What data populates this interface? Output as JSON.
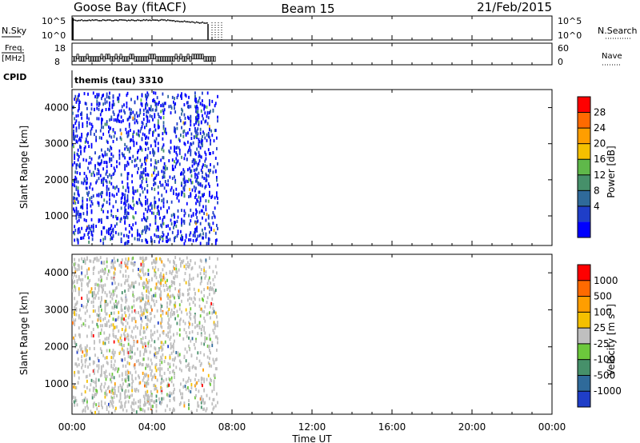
{
  "header": {
    "title": "Goose Bay (fitACF)",
    "beam": "Beam 15",
    "date": "21/Feb/2015"
  },
  "meta_panels": {
    "nsky_label": "N.Sky",
    "nsky_ticks": [
      "10^5",
      "10^0"
    ],
    "nsearch_label": "N.Search",
    "nsearch_ticks": [
      "10^5",
      "10^0"
    ],
    "freq_label_line1": "Freq.",
    "freq_label_line2": "[MHz]",
    "freq_ticks": [
      "18",
      "8"
    ],
    "nave_label": "Nave",
    "nave_ticks": [
      "60",
      "0"
    ],
    "cpid_label": "CPID",
    "cpid_value": "themis (tau) 3310",
    "data_end_hour": 7.3,
    "nsky_level_start": 0.85,
    "nsky_level_drop": 0.7
  },
  "chart_data": [
    {
      "type": "heatmap",
      "name": "power",
      "xlabel": "",
      "ylabel": "Slant Range [km]",
      "x_range_hours": [
        0,
        24
      ],
      "y_range_km": [
        180,
        4500
      ],
      "yticks": [
        1000,
        2000,
        3000,
        4000
      ],
      "data_end_hour": 7.3,
      "colorbar": {
        "label": "Power [dB]",
        "ticks": [
          "28",
          "24",
          "20",
          "16",
          "12",
          "8",
          "4"
        ],
        "colors": [
          "#0000ff",
          "#1f3ec8",
          "#2f6a9a",
          "#46906a",
          "#5fb84a",
          "#f5c000",
          "#ff9e00",
          "#ff6a00",
          "#ff0000"
        ]
      }
    },
    {
      "type": "heatmap",
      "name": "velocity",
      "xlabel": "Time UT",
      "ylabel": "Slant Range [km]",
      "x_range_hours": [
        0,
        24
      ],
      "y_range_km": [
        180,
        4500
      ],
      "yticks": [
        1000,
        2000,
        3000,
        4000
      ],
      "data_end_hour": 7.3,
      "colorbar": {
        "label": "Velocity [m s^-1]",
        "ticks": [
          "1000",
          "500",
          "100",
          "25",
          "-25",
          "-100",
          "-500",
          "-1000"
        ],
        "colors": [
          "#1f3ec8",
          "#2f6a9a",
          "#46906a",
          "#6cc83c",
          "#bfbfbf",
          "#f5c000",
          "#ff9e00",
          "#ff6a00",
          "#ff0000"
        ]
      }
    }
  ],
  "x_axis": {
    "ticks": [
      "00:00",
      "04:00",
      "08:00",
      "12:00",
      "16:00",
      "20:00",
      "00:00"
    ],
    "title": "Time UT"
  }
}
